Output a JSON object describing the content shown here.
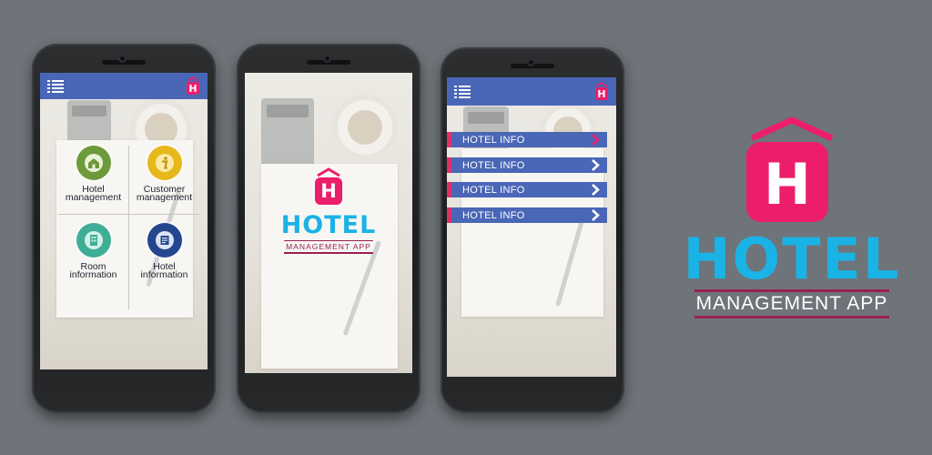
{
  "brand": {
    "logo_letter": "H",
    "title": "HOTEL",
    "subtitle": "MANAGEMENT APP",
    "colors": {
      "pink": "#ec1e6b",
      "cyan": "#1ab3e6",
      "maroon": "#9b1f55",
      "appbar_blue": "#4a66b6"
    }
  },
  "screen1": {
    "menu_icon": "list-menu-icon",
    "tiles": [
      {
        "label_line1": "Hotel",
        "label_line2": "management",
        "icon": "house-icon",
        "color": "#6d9a3a"
      },
      {
        "label_line1": "Customer",
        "label_line2": "management",
        "icon": "info-icon",
        "color": "#e6b81a"
      },
      {
        "label_line1": "Room",
        "label_line2": "information",
        "icon": "building-icon",
        "color": "#3fae96"
      },
      {
        "label_line1": "Hotel",
        "label_line2": "information",
        "icon": "document-icon",
        "color": "#23468e"
      }
    ]
  },
  "screen3": {
    "items": [
      {
        "label": "HOTEL INFO"
      },
      {
        "label": "HOTEL INFO"
      },
      {
        "label": "HOTEL INFO"
      },
      {
        "label": "HOTEL INFO"
      }
    ]
  }
}
